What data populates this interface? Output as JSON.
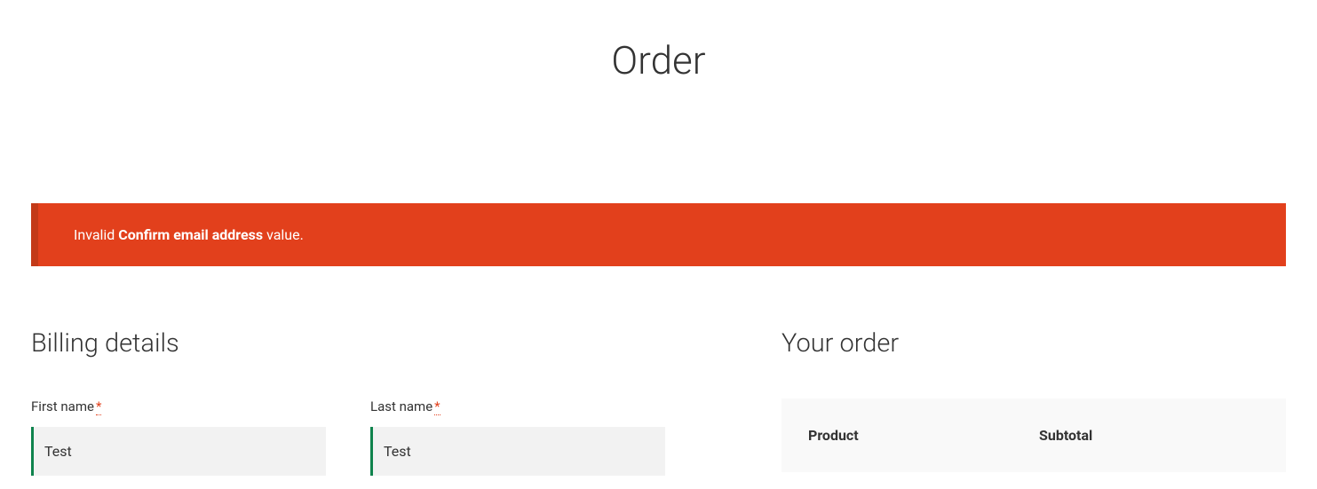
{
  "page_title": "Order",
  "error": {
    "prefix": "Invalid ",
    "bold": "Confirm email address",
    "suffix": " value."
  },
  "billing": {
    "heading": "Billing details",
    "first_name": {
      "label": "First name",
      "required": "*",
      "value": "Test"
    },
    "last_name": {
      "label": "Last name",
      "required": "*",
      "value": "Test"
    }
  },
  "order": {
    "heading": "Your order",
    "columns": {
      "product": "Product",
      "subtotal": "Subtotal"
    }
  }
}
